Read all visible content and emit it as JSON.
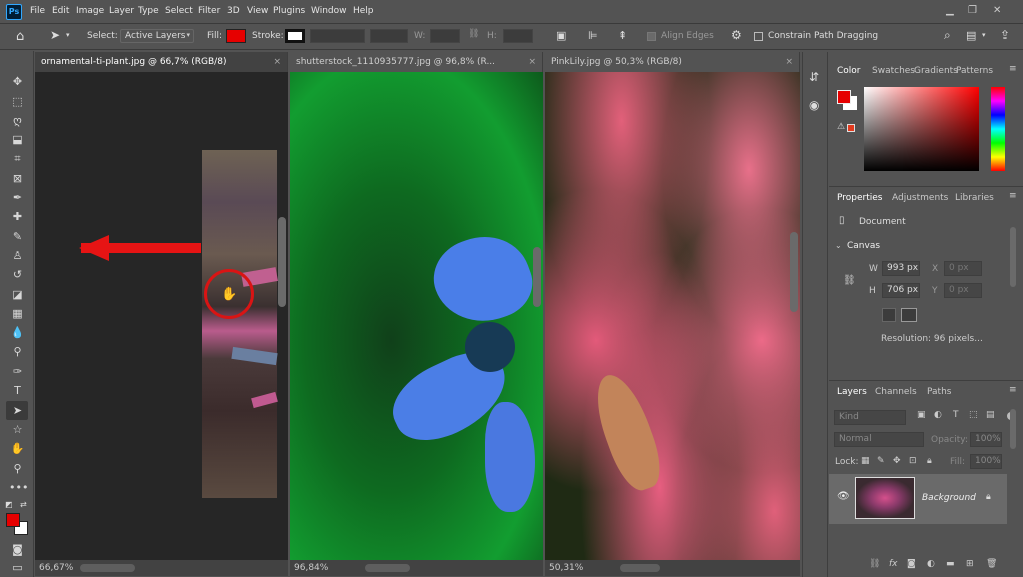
{
  "app": {
    "logo": "Ps"
  },
  "menu": [
    "File",
    "Edit",
    "Image",
    "Layer",
    "Type",
    "Select",
    "Filter",
    "3D",
    "View",
    "Plugins",
    "Window",
    "Help"
  ],
  "options": {
    "select_label": "Select:",
    "select_value": "Active Layers",
    "fill_label": "Fill:",
    "stroke_label": "Stroke:",
    "w_label": "W:",
    "h_label": "H:",
    "align_edges": "Align Edges",
    "constrain": "Constrain Path Dragging",
    "fill_color": "#e60000"
  },
  "tabs": [
    {
      "label": "ornamental-ti-plant.jpg @ 66,7% (RGB/8)",
      "close": "×"
    },
    {
      "label": "shutterstock_1110935777.jpg @ 96,8% (R...",
      "close": "×"
    },
    {
      "label": "PinkLily.jpg @ 50,3% (RGB/8)",
      "close": "×"
    }
  ],
  "status": [
    "66,67%",
    "96,84%",
    "50,31%"
  ],
  "color_panel": {
    "tabs": [
      "Color",
      "Swatches",
      "Gradients",
      "Patterns"
    ],
    "fg": "#e60000",
    "bg": "#ffffff"
  },
  "properties": {
    "tabs": [
      "Properties",
      "Adjustments",
      "Libraries"
    ],
    "doc_label": "Document",
    "canvas_label": "Canvas",
    "w_label": "W",
    "w_value": "993 px",
    "x_label": "X",
    "x_placeholder": "0 px",
    "h_label": "H",
    "h_value": "706 px",
    "y_label": "Y",
    "y_placeholder": "0 px",
    "resolution": "Resolution: 96 pixels..."
  },
  "layers": {
    "tabs": [
      "Layers",
      "Channels",
      "Paths"
    ],
    "kind": "Kind",
    "blend": "Normal",
    "opacity_label": "Opacity:",
    "opacity_value": "100%",
    "lock_label": "Lock:",
    "fill_label": "Fill:",
    "fill_value": "100%",
    "layer_name": "Background"
  }
}
